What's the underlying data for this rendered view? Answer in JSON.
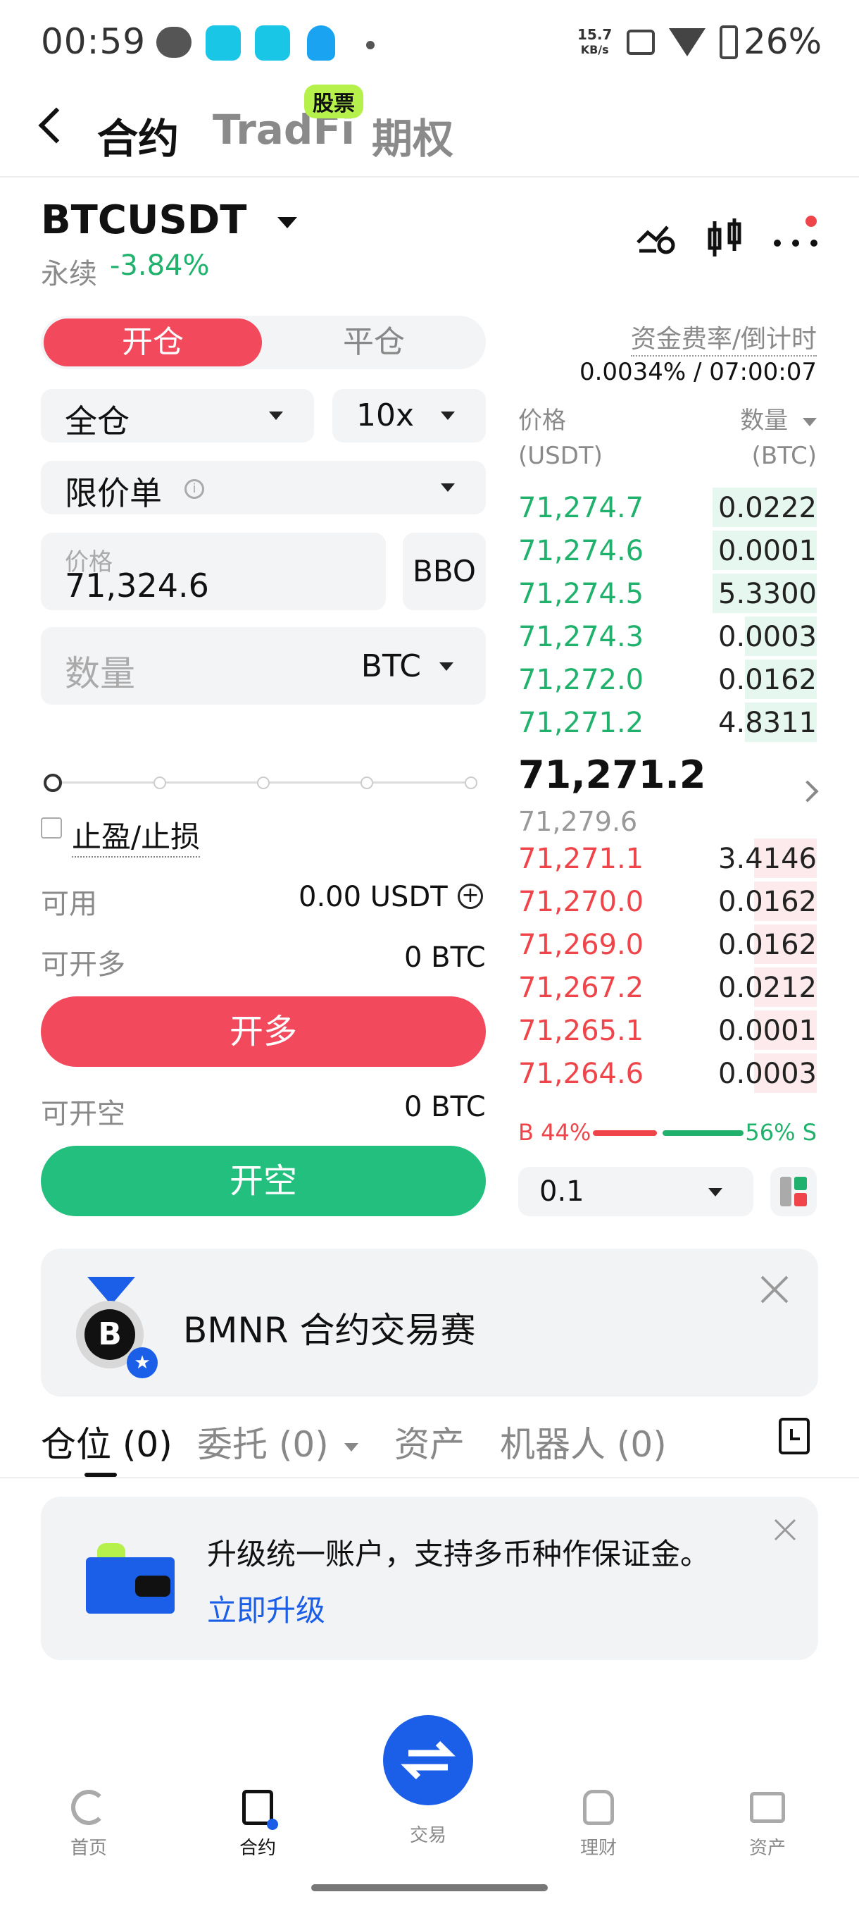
{
  "status_bar": {
    "time": "00:59",
    "net_speed_top": "15.7",
    "net_speed_bottom": "KB/s",
    "battery": "26%"
  },
  "header": {
    "tabs": [
      "合约",
      "TradFi",
      "期权"
    ],
    "badge": "股票"
  },
  "symbol": {
    "name": "BTCUSDT",
    "type": "永续",
    "change": "-3.84%"
  },
  "order_form": {
    "open_tab": "开仓",
    "close_tab": "平仓",
    "margin_mode": "全仓",
    "leverage": "10x",
    "order_type": "限价单",
    "price_label": "价格",
    "price_value": "71,324.6",
    "bbo": "BBO",
    "qty_placeholder": "数量",
    "qty_unit": "BTC",
    "tpsl": "止盈/止损",
    "available_label": "可用",
    "available_value": "0.00 USDT",
    "can_long_label": "可开多",
    "can_long_value": "0 BTC",
    "long_button": "开多",
    "can_short_label": "可开空",
    "can_short_value": "0 BTC",
    "short_button": "开空"
  },
  "funding": {
    "label": "资金费率/倒计时",
    "value": "0.0034% / 07:00:07"
  },
  "orderbook": {
    "price_header": "价格",
    "price_unit": "(USDT)",
    "qty_header": "数量",
    "qty_unit": "(BTC)",
    "asks": [
      {
        "price": "71,274.7",
        "qty": "0.0222",
        "depth": 0.35
      },
      {
        "price": "71,274.6",
        "qty": "0.0001",
        "depth": 0.35
      },
      {
        "price": "71,274.5",
        "qty": "5.3300",
        "depth": 0.35
      },
      {
        "price": "71,274.3",
        "qty": "0.0003",
        "depth": 0.24
      },
      {
        "price": "71,272.0",
        "qty": "0.0162",
        "depth": 0.24
      },
      {
        "price": "71,271.2",
        "qty": "4.8311",
        "depth": 0.24
      }
    ],
    "last_price": "71,271.2",
    "mark_price": "71,279.6",
    "bids": [
      {
        "price": "71,271.1",
        "qty": "3.4146",
        "depth": 0.21
      },
      {
        "price": "71,270.0",
        "qty": "0.0162",
        "depth": 0.21
      },
      {
        "price": "71,269.0",
        "qty": "0.0162",
        "depth": 0.21
      },
      {
        "price": "71,267.2",
        "qty": "0.0212",
        "depth": 0.21
      },
      {
        "price": "71,265.1",
        "qty": "0.0001",
        "depth": 0.21
      },
      {
        "price": "71,264.6",
        "qty": "0.0003",
        "depth": 0.21
      }
    ],
    "buy_ratio": "B 44%",
    "sell_ratio": "56% S",
    "buy_fraction": 0.44,
    "precision": "0.1"
  },
  "banner": {
    "title": "BMNR 合约交易赛"
  },
  "bottom_tabs": [
    "仓位 (0)",
    "委托 (0)",
    "资产",
    "机器人 (0)"
  ],
  "upgrade": {
    "text": "升级统一账户，支持多币种作保证金。",
    "link": "立即升级"
  },
  "nav": {
    "items": [
      "首页",
      "合约",
      "交易",
      "理财",
      "资产"
    ]
  },
  "colors": {
    "green": "#20b26c",
    "red": "#ef454a",
    "link_blue": "#1b5fe8"
  }
}
